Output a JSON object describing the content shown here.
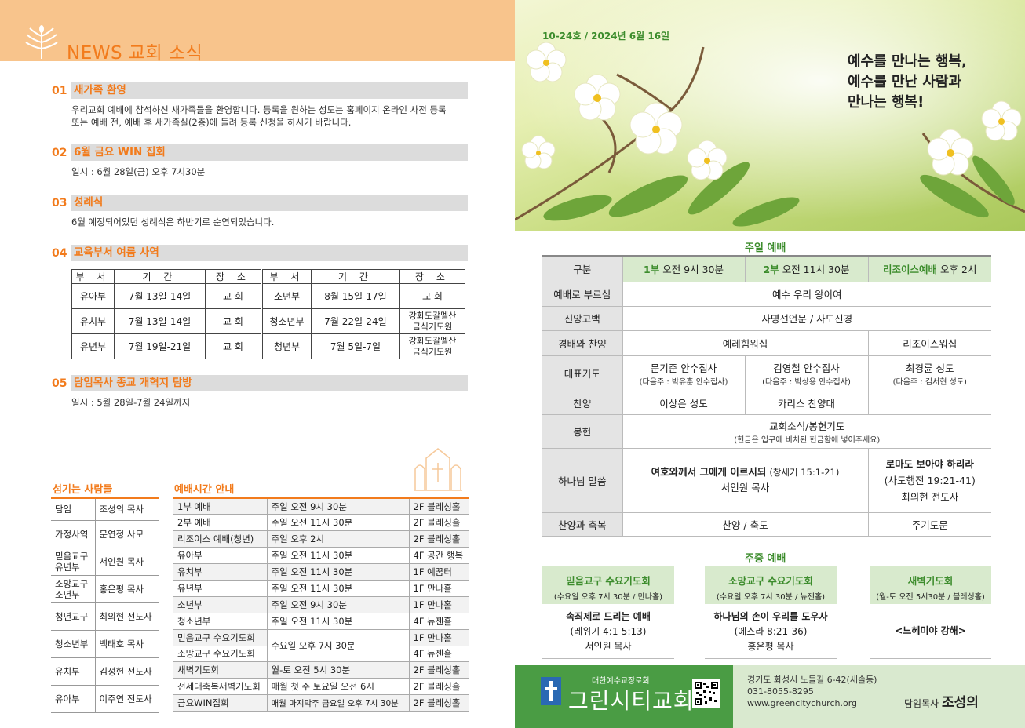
{
  "news": {
    "title": "NEWS 교회 소식",
    "sections": [
      {
        "num": "01",
        "title": "새가족 환영",
        "body": "우리교회 예배에 참석하신 새가족들을 환영합니다. 등록을 원하는 성도는 홈페이지 온라인 사전 등록 또는 예배 전, 예배 후 새가족실(2층)에 들려 등록 신청을 하시기 바랍니다."
      },
      {
        "num": "02",
        "title": "6월 금요 WIN 집회",
        "body": "일시 : 6월 28일(금) 오후 7시30분"
      },
      {
        "num": "03",
        "title": "성례식",
        "body": "6월 예정되어있던 성례식은 하반기로 순연되었습니다."
      },
      {
        "num": "04",
        "title": "교육부서 여름 사역",
        "body": ""
      },
      {
        "num": "05",
        "title": "담임목사 종교 개혁지 탐방",
        "body": "일시 : 5월 28일-7월 24일까지"
      }
    ],
    "edu_table": {
      "headers": [
        "부 서",
        "기 간",
        "장 소",
        "부 서",
        "기 간",
        "장 소"
      ],
      "rows": [
        [
          "유아부",
          "7월 13일-14일",
          "교 회",
          "소년부",
          "8월 15일-17일",
          "교 회"
        ],
        [
          "유치부",
          "7월 13일-14일",
          "교 회",
          "청소년부",
          "7월 22일-24일",
          "강화도갈멜산 금식기도원"
        ],
        [
          "유년부",
          "7월 19일-21일",
          "교 회",
          "청년부",
          "7월 5일-7일",
          "강화도갈멜산 금식기도원"
        ]
      ]
    }
  },
  "people": {
    "title": "섬기는 사람들",
    "rows": [
      [
        "담임",
        "조성의 목사"
      ],
      [
        "가정사역",
        "문연정 사모"
      ],
      [
        "믿음교구 유년부",
        "서인원 목사"
      ],
      [
        "소망교구 소년부",
        "홍은평 목사"
      ],
      [
        "청년교구",
        "최의현 전도사"
      ],
      [
        "청소년부",
        "백태호 목사"
      ],
      [
        "유치부",
        "김성헌 전도사"
      ],
      [
        "유아부",
        "이주연 전도사"
      ]
    ]
  },
  "schedule": {
    "title": "예배시간 안내",
    "rows": [
      [
        "1부 예배",
        "주일 오전 9시 30분",
        "2F 블레싱홀"
      ],
      [
        "2부 예배",
        "주일 오전 11시 30분",
        "2F 블레싱홀"
      ],
      [
        "리조이스 예배(청년)",
        "주일 오후 2시",
        "2F 블레싱홀"
      ],
      [
        "유아부",
        "주일 오전 11시 30분",
        "4F 공간 행복"
      ],
      [
        "유치부",
        "주일 오전 11시 30분",
        "1F 예꿈터"
      ],
      [
        "유년부",
        "주일 오전 11시 30분",
        "1F 만나홀"
      ],
      [
        "소년부",
        "주일 오전 9시 30분",
        "1F 만나홀"
      ],
      [
        "청소년부",
        "주일 오전 11시 30분",
        "4F 뉴젠홀"
      ],
      [
        "믿음교구 수요기도회",
        "수요일 오후 7시 30분",
        "1F 만나홀"
      ],
      [
        "소망교구 수요기도회",
        "",
        "4F 뉴젠홀"
      ],
      [
        "새벽기도회",
        "월-토 오전 5시 30분",
        "2F 블레싱홀"
      ],
      [
        "전세대축복새벽기도회",
        "매월 첫 주 토요일 오전 6시",
        "2F 블레싱홀"
      ],
      [
        "금요WIN집회",
        "매월 마지막주 금요일 오후 7시 30분",
        "2F 블레싱홀"
      ]
    ]
  },
  "bulletin": {
    "issue": "10-24호 / 2024년 6월 16일",
    "slogan_1": "예수를 만나는 행복,",
    "slogan_2": "예수를 만난 사람과",
    "slogan_3": "만나는 행복!"
  },
  "sunday": {
    "title": "주일 예배",
    "label_head": "구분",
    "s1_name": "1부",
    "s1_time": "오전 9시 30분",
    "s2_name": "2부",
    "s2_time": "오전 11시 30분",
    "s3_name": "리조이스예배",
    "s3_time": "오후 2시",
    "call_label": "예배로 부르심",
    "call": "예수 우리 왕이여",
    "creed_label": "신앙고백",
    "creed": "사명선언문 / 사도신경",
    "praise_label": "경배와 찬양",
    "praise_12": "예레힘워십",
    "praise_3": "리조이스워십",
    "prayer_label": "대표기도",
    "prayer_1": "문기준 안수집사",
    "prayer_1_next": "(다음주 : 박유훈 안수집사)",
    "prayer_2": "김영철 안수집사",
    "prayer_2_next": "(다음주 : 박상용 안수집사)",
    "prayer_3": "최경륜 성도",
    "prayer_3_next": "(다음주 : 김서현 성도)",
    "choir_label": "찬양",
    "choir_1": "이상은 성도",
    "choir_2": "카리스 찬양대",
    "choir_3": "",
    "offering_label": "봉헌",
    "offering": "교회소식/봉헌기도",
    "offering_note": "(헌금은 입구에 비치된 헌금함에 넣어주세요)",
    "word_label": "하나님 말씀",
    "word_12_title": "여호와께서 그에게 이르시되",
    "word_12_ref": "(창세기 15:1-21)",
    "word_12_preacher": "서인원 목사",
    "word_3_title": "로마도 보아야 하리라",
    "word_3_ref": "(사도행전 19:21-41)",
    "word_3_preacher": "최의현 전도사",
    "end_label": "찬양과 축복",
    "end_12": "찬양 / 축도",
    "end_3": "주기도문"
  },
  "midweek": {
    "title": "주중 예배",
    "items": [
      {
        "name": "믿음교구 수요기도회",
        "time": "(수요일 오후 7시 30분 / 만나홀)",
        "sermon": "속죄제로 드리는 예배",
        "ref": "(레위기 4:1-5:13)",
        "preacher": "서인원 목사"
      },
      {
        "name": "소망교구 수요기도회",
        "time": "(수요일 오후 7시 30분 / 뉴젠홀)",
        "sermon": "하나님의 손이 우리를 도우사",
        "ref": "(에스라 8:21-36)",
        "preacher": "홍은평 목사"
      },
      {
        "name": "새벽기도회",
        "time": "(월-토 오전 5시30분 / 블레싱홀)",
        "sermon": "<느헤미야 강해>",
        "ref": "",
        "preacher": ""
      }
    ]
  },
  "footer": {
    "denomination": "대한예수교장로회",
    "church_name": "그린시티교회",
    "address": "경기도 화성시 노들길 6-42(새솔동)",
    "phone": "031-8055-8295",
    "website": "www.greencitychurch.org",
    "pastor_label": "담임목사",
    "pastor_name": "조성의"
  }
}
